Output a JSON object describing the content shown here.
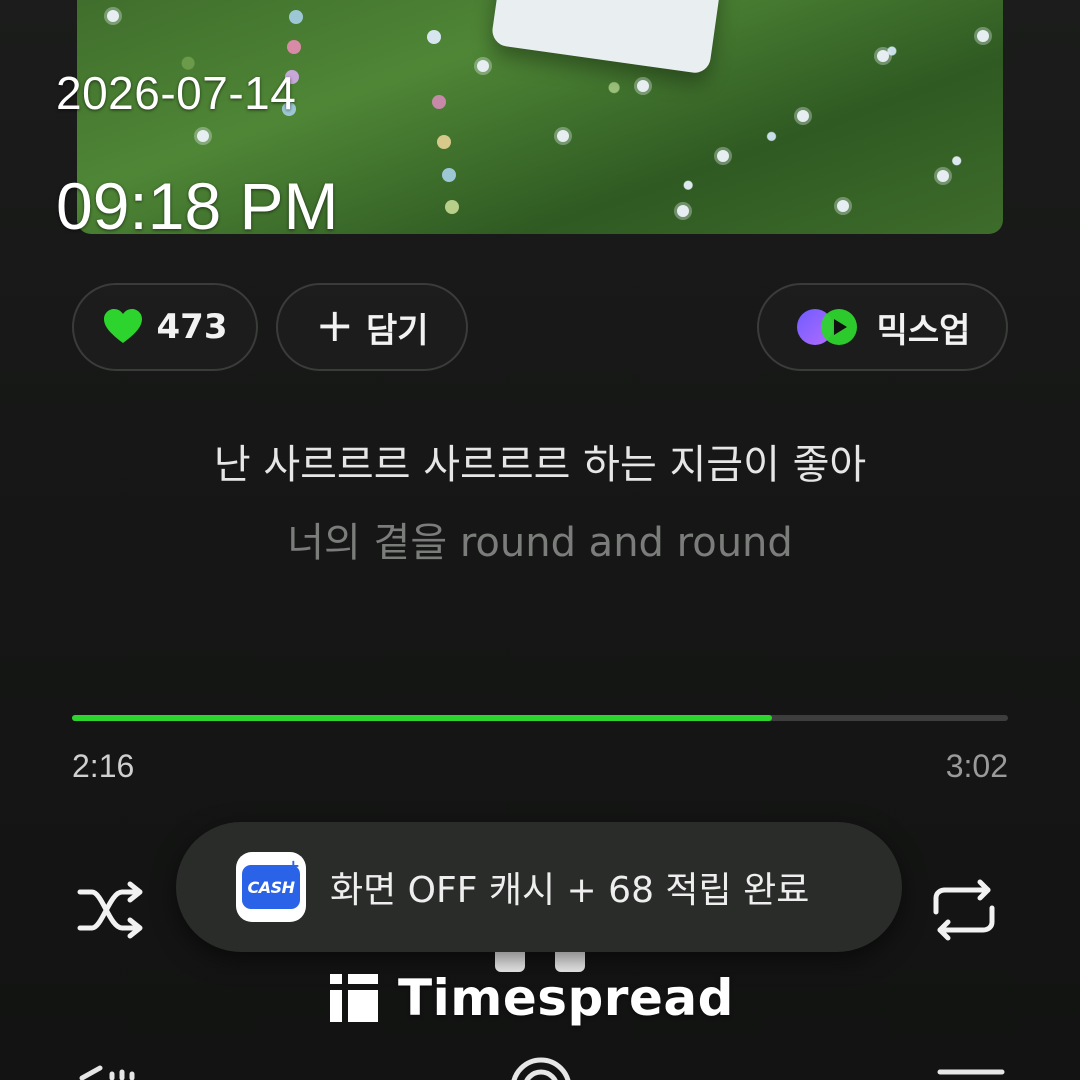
{
  "overlay": {
    "date": "2026-07-14",
    "time": "09:18 PM"
  },
  "actions": {
    "like_count": "473",
    "add_label": "담기",
    "mixup_label": "믹스업"
  },
  "lyrics": {
    "current": "난 사르르르 사르르르 하는 지금이 좋아",
    "next": "너의 곁을 round and round"
  },
  "playback": {
    "elapsed": "2:16",
    "total": "3:02",
    "progress_fraction": 0.748
  },
  "toast": {
    "icon_text": "CASH",
    "message": "화면 OFF 캐시 + 68 적립 완료"
  },
  "watermark": {
    "text": "Timespread"
  },
  "icons": {
    "like": "heart-icon",
    "add": "plus-icon",
    "mixup": "mixup-logo-icon",
    "shuffle": "shuffle-icon",
    "repeat": "repeat-icon"
  },
  "colors": {
    "accent": "#2ed42e",
    "background": "#161716",
    "cash_blue": "#2a63e8"
  }
}
